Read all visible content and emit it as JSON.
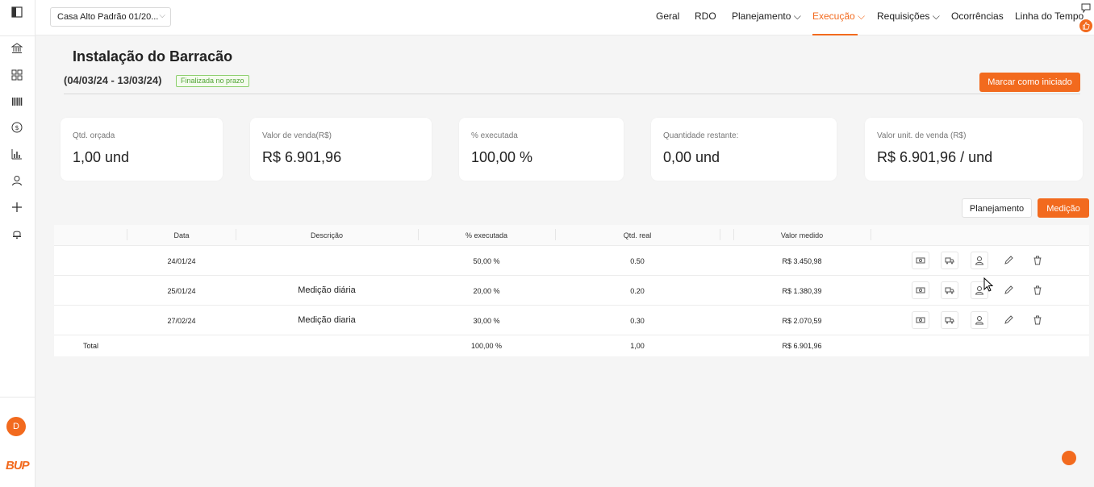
{
  "topbar": {
    "project": "Casa Alto Padrão 01/20...",
    "nav": [
      {
        "label": "Geral"
      },
      {
        "label": "RDO"
      },
      {
        "label": "Planejamento"
      },
      {
        "label": "Execução"
      },
      {
        "label": "Requisições"
      },
      {
        "label": "Ocorrências"
      },
      {
        "label": "Linha do Tempo"
      }
    ],
    "active_nav": "Execução"
  },
  "page": {
    "title": "Instalação do Barracão",
    "date_range": "(04/03/24 - 13/03/24)",
    "status": "Finalizada no prazo",
    "mark_button": "Marcar como iniciado"
  },
  "cards": [
    {
      "label": "Qtd. orçada",
      "value": "1,00 und"
    },
    {
      "label": "Valor de venda(R$)",
      "value": "R$ 6.901,96"
    },
    {
      "label": "% executada",
      "value": "100,00 %"
    },
    {
      "label": "Quantidade restante:",
      "value": "0,00 und"
    },
    {
      "label": "Valor unit. de venda (R$)",
      "value": "R$ 6.901,96 / und"
    }
  ],
  "tabs": {
    "planejamento": "Planejamento",
    "medicao": "Medição"
  },
  "table": {
    "headers": {
      "data": "Data",
      "descricao": "Descrição",
      "executada": "% executada",
      "qtd": "Qtd. real",
      "valor": "Valor medido"
    },
    "rows": [
      {
        "data": "24/01/24",
        "descricao": "",
        "executada": "50,00 %",
        "qtd": "0.50",
        "valor": "R$ 3.450,98"
      },
      {
        "data": "25/01/24",
        "descricao": "Medição diária",
        "executada": "20,00 %",
        "qtd": "0.20",
        "valor": "R$ 1.380,39"
      },
      {
        "data": "27/02/24",
        "descricao": "Medição diaria",
        "executada": "30,00 %",
        "qtd": "0.30",
        "valor": "R$ 2.070,59"
      }
    ],
    "total": {
      "label": "Total",
      "executada": "100,00 %",
      "qtd": "1,00",
      "valor": "R$ 6.901,96"
    }
  },
  "user": {
    "initial": "D"
  },
  "brand": {
    "logo": "BUP",
    "accent": "#f26a1e"
  }
}
